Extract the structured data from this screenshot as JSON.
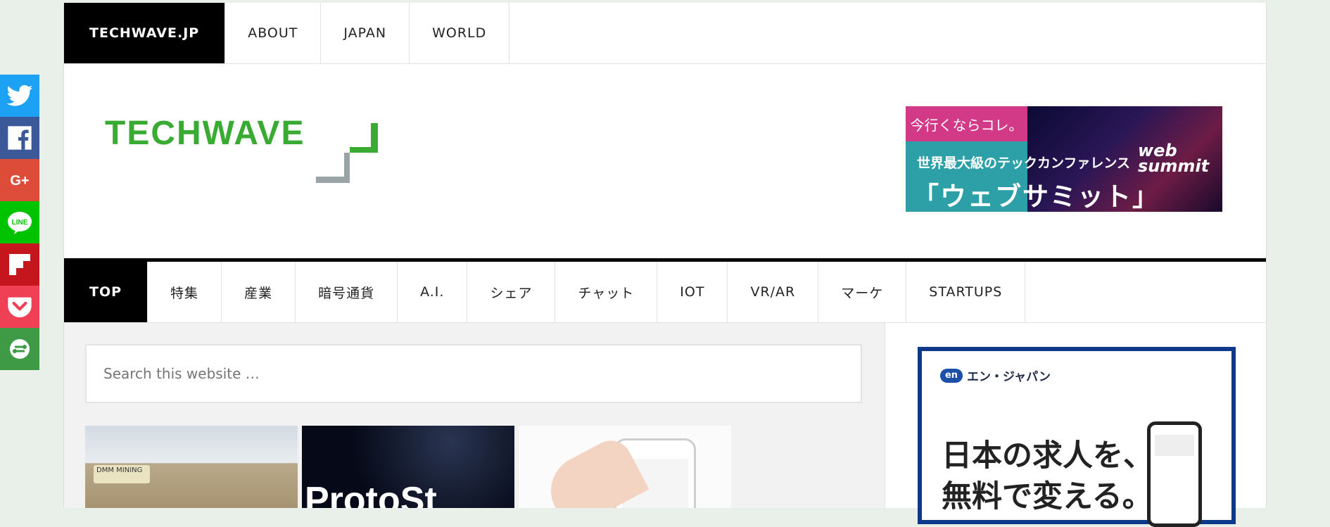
{
  "share": [
    {
      "name": "twitter",
      "color": "#1da1f2"
    },
    {
      "name": "facebook",
      "color": "#3b5998"
    },
    {
      "name": "google-plus",
      "color": "#dd4b39",
      "label": "G+"
    },
    {
      "name": "line",
      "color": "#00c300",
      "label": "LINE"
    },
    {
      "name": "flipboard",
      "color": "#c4161c"
    },
    {
      "name": "pocket",
      "color": "#ef4056"
    },
    {
      "name": "more",
      "color": "#3e9a44"
    }
  ],
  "topnav": {
    "brand": "TECHWAVE.JP",
    "items": [
      "ABOUT",
      "JAPAN",
      "WORLD"
    ]
  },
  "logo": {
    "text": "TECHWAVE",
    "green": "#3aab32",
    "gray": "#9aa3a6"
  },
  "banner1": {
    "tag": "今行くならコレ。",
    "line1": "世界最大級のテックカンファレンス",
    "line2": "「ウェブサミット」",
    "logo_top": "web",
    "logo_bottom": "summit"
  },
  "mainnav": {
    "active": "TOP",
    "items": [
      "特集",
      "産業",
      "暗号通貨",
      "A.I.",
      "シェア",
      "チャット",
      "IOT",
      "VR/AR",
      "マーケ",
      "STARTUPS"
    ]
  },
  "search": {
    "placeholder": "Search this website …"
  },
  "thumbs": {
    "t1_sign": "DMM MINING",
    "t2_text": "ProtoSt"
  },
  "sidebar_ad": {
    "brand_mark": "en",
    "brand": "エン・ジャパン",
    "line1": "日本の求人を、",
    "line2": "無料で変える。"
  }
}
